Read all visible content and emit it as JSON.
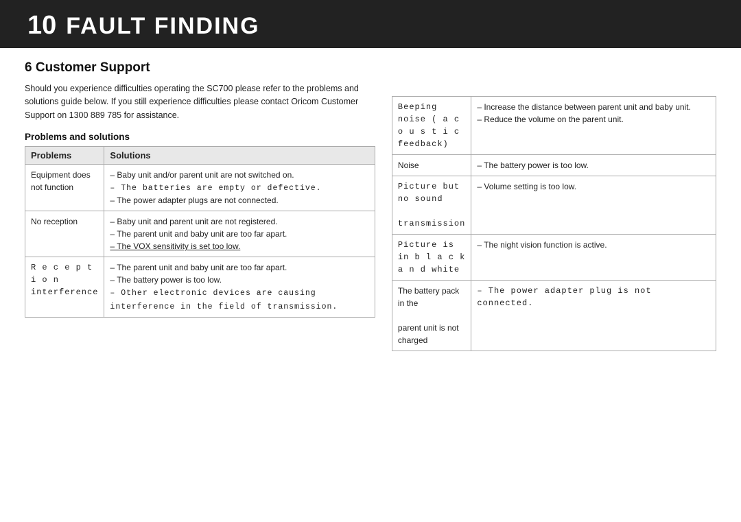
{
  "header": {
    "chapter_number": "10",
    "chapter_title": "FAULT FINDING"
  },
  "section": {
    "title": "6 Customer Support",
    "intro": "Should you experience difficulties operating the SC700 please refer to the problems and solutions guide below. If you still experience difficulties please contact Oricom Customer Support on 1300 889 785 for assistance.",
    "subsection_title": "Problems and solutions",
    "table_headers": [
      "Problems",
      "Solutions"
    ],
    "left_rows": [
      {
        "problem": "Equipment does not function",
        "solutions": [
          "– Baby unit and/or parent unit are not switched on.",
          "– The batteries are empty or defective.",
          "– The power adapter plugs are not connected."
        ],
        "solution_styles": [
          "normal",
          "mono",
          "normal"
        ]
      },
      {
        "problem": "No reception",
        "solutions": [
          "– Baby unit and parent unit are not registered.",
          "– The parent unit and baby unit are too far apart.",
          "– The VOX sensitivity is set too low."
        ],
        "solution_styles": [
          "normal",
          "normal",
          "underline"
        ]
      },
      {
        "problem": "Reception interference",
        "problem_style": "mono",
        "solutions": [
          "– The parent unit and baby unit are too far apart.",
          "– The battery power is too low.",
          "– Other electronic devices are causing interference in the field of transmission."
        ],
        "solution_styles": [
          "normal",
          "normal",
          "mono"
        ]
      }
    ],
    "right_rows": [
      {
        "problem": "Beeping noise (acoustic feedback)",
        "problem_style": "mono",
        "solutions": [
          "– Increase the distance between parent unit and baby unit.",
          "– Reduce the volume on the parent unit."
        ]
      },
      {
        "problem": "Noise",
        "solutions": [
          "– The battery power is too low."
        ]
      },
      {
        "problem": "Picture but no sound transmission",
        "problem_style": "mono",
        "solutions": [
          "– Volume setting is too low."
        ]
      },
      {
        "problem": "Picture is in black and white",
        "problem_style": "mono",
        "solutions": [
          "– The night vision function is active."
        ]
      },
      {
        "problem": "The battery pack in the parent unit is not charged",
        "solutions": [
          "– The power adapter plug is not connected."
        ],
        "solution_style": "mono"
      }
    ]
  }
}
